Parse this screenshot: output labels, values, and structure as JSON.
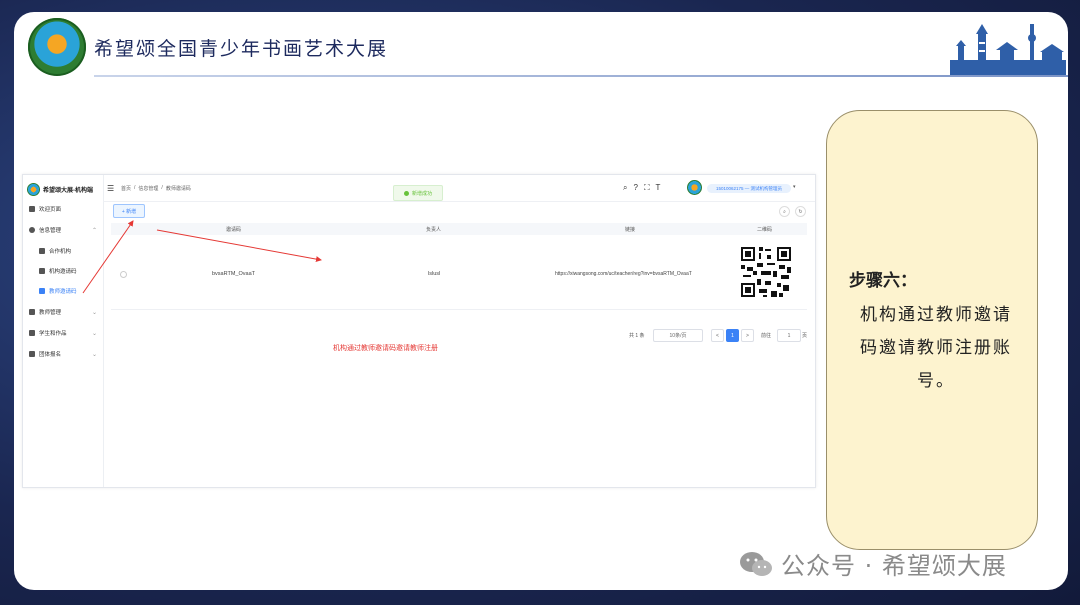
{
  "header": {
    "title": "希望颂全国青少年书画艺术大展"
  },
  "app": {
    "brand": "希望颂大展-机构端",
    "sidebar": [
      {
        "label": "欢迎页面",
        "icon": "dashboard-icon"
      },
      {
        "label": "信息管理",
        "icon": "gear-icon"
      },
      {
        "label": "合作机构",
        "icon": "user-icon",
        "sub": true
      },
      {
        "label": "机构邀请码",
        "icon": "user-icon",
        "sub": true
      },
      {
        "label": "教师邀请码",
        "icon": "user-icon",
        "sub": true,
        "active": true
      },
      {
        "label": "教师管理",
        "icon": "monitor-icon"
      },
      {
        "label": "学生和作品",
        "icon": "monitor-icon"
      },
      {
        "label": "团体报名",
        "icon": "monitor-icon"
      }
    ],
    "breadcrumb": [
      "首页",
      "/",
      "信息管理",
      "/",
      "教师邀请码"
    ],
    "toast": "新增成功",
    "user": "15010062175 — 测试机构管理员",
    "add_button": "+ 新增",
    "table": {
      "headers": [
        "邀请码",
        "负责人",
        "链接",
        "二维码"
      ],
      "row": {
        "code": "bvsaRTM_OvaaT",
        "owner": "lslusl",
        "link": "https://xiwangsong.com/uc/teacher/reg?inv=bvsaRTM_OvaaT"
      }
    },
    "pager": {
      "total": "共 1 条",
      "page_size": "10条/页",
      "prev": "<",
      "current": "1",
      "next": ">",
      "goto_label": "前往",
      "goto_value": "1",
      "page_unit": "页"
    },
    "annotation": "机构通过教师邀请码邀请教师注册"
  },
  "note": {
    "title": "步骤六：",
    "body": "机构通过教师邀请码邀请教师注册账号。"
  },
  "watermark": "公众号 · 希望颂大展",
  "colors": {
    "accent": "#3b82f6",
    "note_bg": "#fdf3cf",
    "arrow": "#e53935"
  }
}
